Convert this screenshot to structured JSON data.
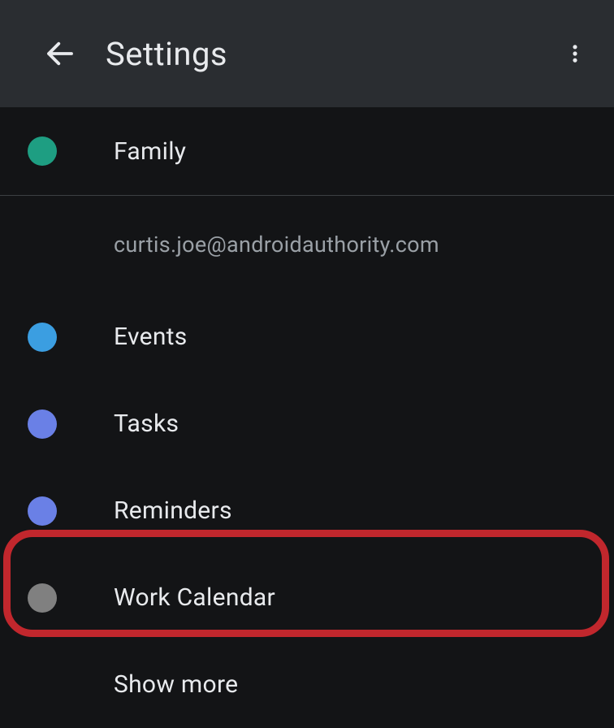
{
  "header": {
    "title": "Settings"
  },
  "sections": {
    "top": {
      "items": [
        {
          "label": "Family",
          "color": "#1e9e82"
        }
      ]
    },
    "account": {
      "email": "curtis.joe@androidauthority.com",
      "items": [
        {
          "label": "Events",
          "color": "#3b9ee1"
        },
        {
          "label": "Tasks",
          "color": "#6a80e6"
        },
        {
          "label": "Reminders",
          "color": "#6a80e6"
        },
        {
          "label": "Work Calendar",
          "color": "#808080"
        }
      ]
    },
    "showMoreLabel": "Show more"
  },
  "highlight": {
    "target": "Work Calendar"
  }
}
